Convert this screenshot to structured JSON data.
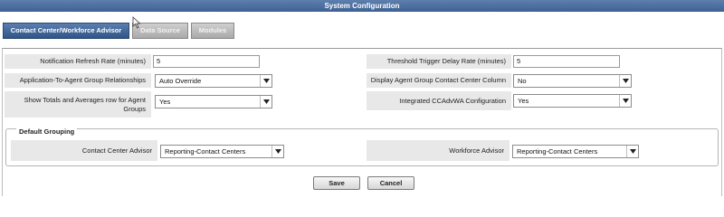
{
  "window": {
    "title": "System Configuration"
  },
  "tabs": [
    {
      "label": "Contact Center/Workforce Advisor",
      "active": true
    },
    {
      "label": "Data Source",
      "active": false
    },
    {
      "label": "Modules",
      "active": false
    }
  ],
  "form": {
    "notification_refresh": {
      "label": "Notification Refresh Rate (minutes)",
      "value": "5"
    },
    "threshold_delay": {
      "label": "Threshold Trigger Delay Rate (minutes)",
      "value": "5"
    },
    "app_agent_group": {
      "label": "Application-To-Agent Group Relationships",
      "value": "Auto Override"
    },
    "display_agent_column": {
      "label": "Display Agent Group Contact Center Column",
      "value": "No"
    },
    "show_totals": {
      "label": "Show Totals and Averages row for Agent Groups",
      "value": "Yes"
    },
    "integrated_config": {
      "label": "Integrated CCAdvWA Configuration",
      "value": "Yes"
    }
  },
  "default_grouping": {
    "legend": "Default Grouping",
    "contact_center_advisor": {
      "label": "Contact Center Advisor",
      "value": "Reporting-Contact Centers"
    },
    "workforce_advisor": {
      "label": "Workforce Advisor",
      "value": "Reporting-Contact Centers"
    }
  },
  "buttons": {
    "save": "Save",
    "cancel": "Cancel"
  },
  "colors": {
    "title_bar": "#3e6193",
    "active_tab": "#2f5486",
    "label_bg": "#e8e8e8"
  },
  "icons": {
    "dropdown": "chevron-down-icon",
    "pointer": "mouse-pointer-icon"
  }
}
